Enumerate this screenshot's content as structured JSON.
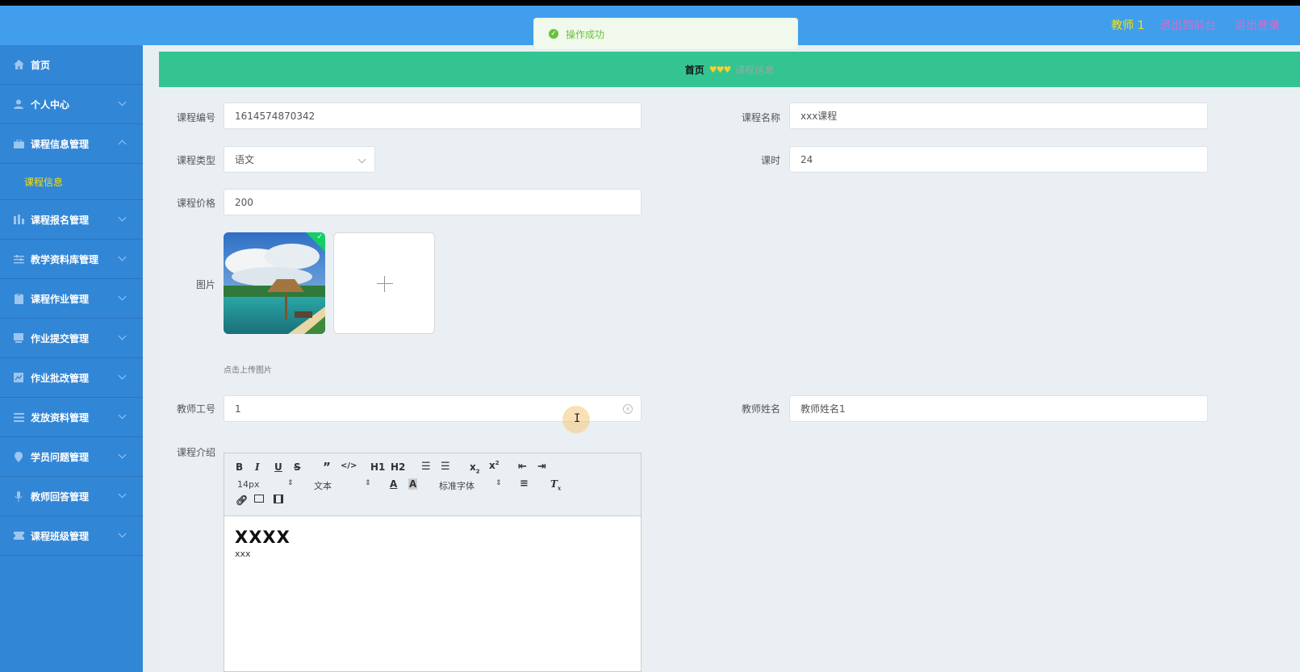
{
  "header": {
    "user_name": "教师 1",
    "back_to_front": "退出到前台",
    "logout": "退出登录",
    "colors": {
      "bg": "#409eec",
      "user": "#f5e10a",
      "links": "#e268c6"
    }
  },
  "toast": {
    "icon": "check-circle-icon",
    "message": "操作成功"
  },
  "sidebar": {
    "items": [
      {
        "label": "首页",
        "icon": "home-icon",
        "chevron": false
      },
      {
        "label": "个人中心",
        "icon": "user-icon",
        "chevron": true
      },
      {
        "label": "课程信息管理",
        "icon": "briefcase-icon",
        "chevron": true,
        "expanded": true,
        "children": [
          {
            "label": "课程信息"
          }
        ]
      },
      {
        "label": "课程报名管理",
        "icon": "bar-chart-icon",
        "chevron": true
      },
      {
        "label": "教学资料库管理",
        "icon": "sliders-icon",
        "chevron": true
      },
      {
        "label": "课程作业管理",
        "icon": "clipboard-icon",
        "chevron": true
      },
      {
        "label": "作业提交管理",
        "icon": "inbox-icon",
        "chevron": true
      },
      {
        "label": "作业批改管理",
        "icon": "chart-box-icon",
        "chevron": true
      },
      {
        "label": "发放资料管理",
        "icon": "list-icon",
        "chevron": true
      },
      {
        "label": "学员问题管理",
        "icon": "location-pin-icon",
        "chevron": true
      },
      {
        "label": "教师回答管理",
        "icon": "microphone-icon",
        "chevron": true
      },
      {
        "label": "课程班级管理",
        "icon": "ticket-icon",
        "chevron": true
      }
    ]
  },
  "breadcrumb": {
    "home": "首页",
    "separator": "♥♥♥",
    "current": "课程信息"
  },
  "form": {
    "course_no": {
      "label": "课程编号",
      "value": "1614574870342"
    },
    "course_name": {
      "label": "课程名称",
      "value": "xxx课程"
    },
    "course_type": {
      "label": "课程类型",
      "value": "语文"
    },
    "hours": {
      "label": "课时",
      "value": "24"
    },
    "price": {
      "label": "课程价格",
      "value": "200"
    },
    "image": {
      "label": "图片",
      "hint": "点击上传图片"
    },
    "teacher_no": {
      "label": "教师工号",
      "value": "1"
    },
    "teacher_name": {
      "label": "教师姓名",
      "value": "教师姓名1"
    },
    "intro": {
      "label": "课程介绍",
      "toolbar": {
        "font_size": "14px",
        "paragraph": "文本",
        "font_family": "标准字体"
      },
      "heading": "XXXX",
      "body": "xxx"
    }
  }
}
